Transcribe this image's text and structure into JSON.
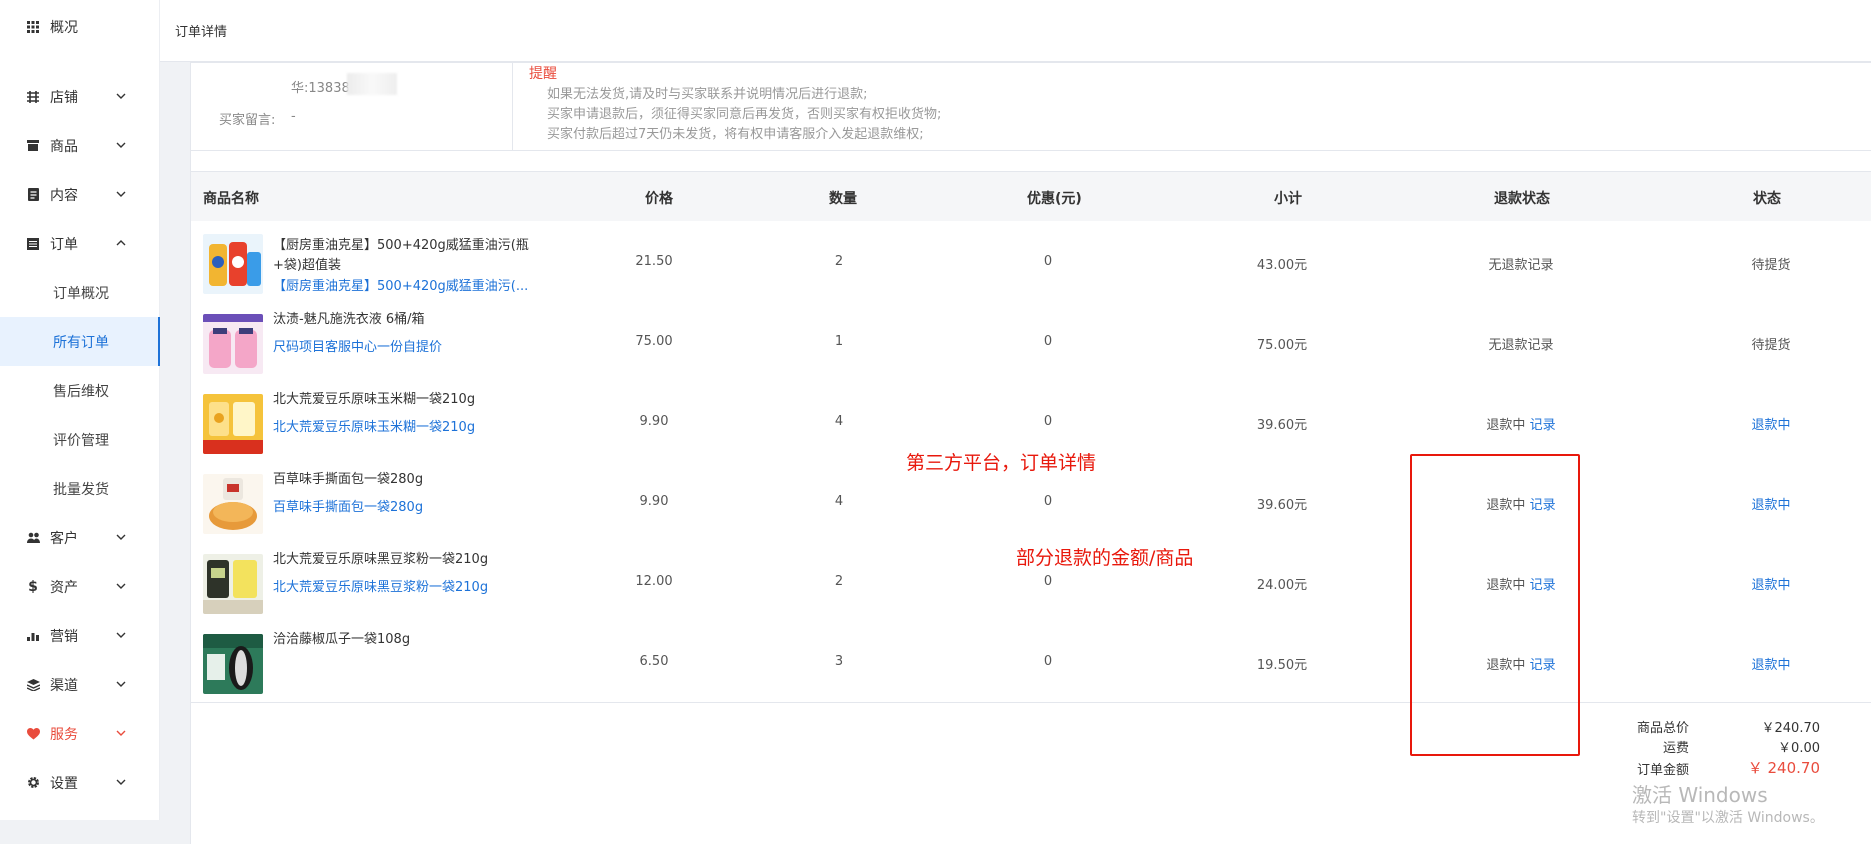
{
  "sidebar": {
    "top_item": "概况",
    "items": [
      {
        "label": "店铺",
        "icon": "store-icon"
      },
      {
        "label": "商品",
        "icon": "goods-icon"
      },
      {
        "label": "内容",
        "icon": "content-icon"
      },
      {
        "label": "订单",
        "icon": "order-icon"
      }
    ],
    "sub_items": [
      {
        "label": "订单概况"
      },
      {
        "label": "所有订单"
      },
      {
        "label": "售后维权"
      },
      {
        "label": "评价管理"
      },
      {
        "label": "批量发货"
      }
    ],
    "items_after": [
      {
        "label": "客户",
        "icon": "customer-icon"
      },
      {
        "label": "资产",
        "icon": "dollar-icon"
      },
      {
        "label": "营销",
        "icon": "chart-icon"
      },
      {
        "label": "渠道",
        "icon": "layers-icon"
      },
      {
        "label": "服务",
        "icon": "heart-icon"
      },
      {
        "label": "设置",
        "icon": "gear-icon"
      }
    ]
  },
  "header": {
    "title": "订单详情"
  },
  "order_info": {
    "phone": "华:13838",
    "msg_label": "买家留言:",
    "msg_value": "-",
    "reminder_title": "提醒",
    "reminder_lines": [
      "如果无法发货,请及时与买家联系并说明情况后进行退款;",
      "买家申请退款后，须征得买家同意后再发货，否则买家有权拒收货物;",
      "买家付款后超过7天仍未发货，将有权申请客服介入发起退款维权;"
    ]
  },
  "table": {
    "headers": {
      "name": "商品名称",
      "price": "价格",
      "qty": "数量",
      "discount": "优惠(元)",
      "subtotal": "小计",
      "refund_status": "退款状态",
      "status": "状态"
    },
    "rows": [
      {
        "name": "【厨房重油克星】500+420g威猛重油污(瓶+袋)超值装",
        "sku": "【厨房重油克星】500+420g威猛重油污(...",
        "price": "21.50",
        "qty": "2",
        "discount": "0",
        "subtotal": "43.00元",
        "refund_text": "无退款记录",
        "refund_link": "",
        "status": "待提货",
        "status_link": false
      },
      {
        "name": "汰渍-魅凡施洗衣液 6桶/箱",
        "sku": "尺码项目客服中心一份自提价",
        "price": "75.00",
        "qty": "1",
        "discount": "0",
        "subtotal": "75.00元",
        "refund_text": "无退款记录",
        "refund_link": "",
        "status": "待提货",
        "status_link": false
      },
      {
        "name": "北大荒爱豆乐原味玉米糊一袋210g",
        "sku": "北大荒爱豆乐原味玉米糊一袋210g",
        "price": "9.90",
        "qty": "4",
        "discount": "0",
        "subtotal": "39.60元",
        "refund_text": "退款中",
        "refund_link": "记录",
        "status": "退款中",
        "status_link": true
      },
      {
        "name": "百草味手撕面包一袋280g",
        "sku": "百草味手撕面包一袋280g",
        "price": "9.90",
        "qty": "4",
        "discount": "0",
        "subtotal": "39.60元",
        "refund_text": "退款中",
        "refund_link": "记录",
        "status": "退款中",
        "status_link": true
      },
      {
        "name": "北大荒爱豆乐原味黑豆浆粉一袋210g",
        "sku": "北大荒爱豆乐原味黑豆浆粉一袋210g",
        "price": "12.00",
        "qty": "2",
        "discount": "0",
        "subtotal": "24.00元",
        "refund_text": "退款中",
        "refund_link": "记录",
        "status": "退款中",
        "status_link": true
      },
      {
        "name": "洽洽藤椒瓜子一袋108g",
        "sku": "",
        "price": "6.50",
        "qty": "3",
        "discount": "0",
        "subtotal": "19.50元",
        "refund_text": "退款中",
        "refund_link": "记录",
        "status": "退款中",
        "status_link": true
      }
    ]
  },
  "summary": {
    "goods_total_label": "商品总价",
    "goods_total": "￥240.70",
    "freight_label": "运费",
    "freight": "￥0.00",
    "order_amount_label": "订单金额",
    "order_amount": "￥ 240.70"
  },
  "annotations": {
    "note1": "第三方平台，订单详情",
    "note2": "部分退款的金额/商品"
  },
  "watermark": {
    "line1": "激活 Windows",
    "line2": "转到\"设置\"以激活 Windows。"
  },
  "colors": {
    "accent": "#1d72d8",
    "danger": "#e94c3d",
    "annotation": "#e8180c"
  }
}
